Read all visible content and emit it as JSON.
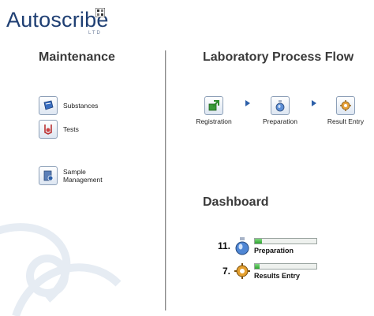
{
  "logo": {
    "text": "Autoscribe",
    "subtext": "LTD"
  },
  "maintenance": {
    "title": "Maintenance",
    "items": [
      {
        "label": "Substances",
        "icon": "substances-icon"
      },
      {
        "label": "Tests",
        "icon": "tests-icon"
      },
      {
        "label": "Sample\nManagement",
        "icon": "sample-management-icon"
      }
    ]
  },
  "process_flow": {
    "title": "Laboratory Process Flow",
    "steps": [
      {
        "label": "Registration",
        "icon": "registration-icon"
      },
      {
        "label": "Preparation",
        "icon": "preparation-icon"
      },
      {
        "label": "Result Entry",
        "icon": "result-entry-icon"
      }
    ]
  },
  "dashboard": {
    "title": "Dashboard",
    "rows": [
      {
        "count": "11.",
        "label": "Preparation",
        "progress": 0.12,
        "icon": "preparation-icon"
      },
      {
        "count": "7.",
        "label": "Results Entry",
        "progress": 0.08,
        "icon": "result-entry-icon"
      }
    ]
  },
  "colors": {
    "accent": "#2c5fa8",
    "logo": "#1f3f73",
    "progress": "#2ea52e"
  }
}
